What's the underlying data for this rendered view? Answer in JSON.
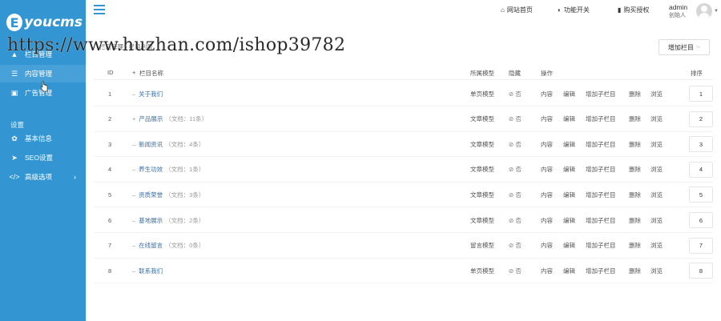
{
  "brand": {
    "logo_letter": "E",
    "logo_text": "youcms"
  },
  "sidebar": {
    "items": [
      {
        "label": "栏目管理",
        "icon": "sitemap-icon"
      },
      {
        "label": "内容管理",
        "icon": "list-icon"
      },
      {
        "label": "广告管理",
        "icon": "image-icon"
      }
    ],
    "section_label": "设置",
    "settings": [
      {
        "label": "基本信息",
        "icon": "gear-icon"
      },
      {
        "label": "SEO设置",
        "icon": "paper-plane-icon"
      },
      {
        "label": "高级选项",
        "icon": "code-icon",
        "chevron": "›"
      }
    ]
  },
  "topbar": {
    "links": [
      {
        "label": "网站首页",
        "icon": "home-icon"
      },
      {
        "label": "功能开关",
        "icon": "toggle-icon"
      },
      {
        "label": "购买授权",
        "icon": "bookmark-icon"
      }
    ],
    "admin_name": "admin",
    "admin_role": "创始人"
  },
  "page": {
    "breadcrumb": "栏目管理 › 栏目列表",
    "add_button": "增加栏目",
    "add_button_caret": "⌵"
  },
  "watermark": "https://www.huzhan.com/ishop39782",
  "table": {
    "headers": {
      "id": "ID",
      "expand": "+",
      "name": "栏目名称",
      "model": "所属模型",
      "hidden": "隐藏",
      "actions": "操作",
      "sort": "排序"
    },
    "rows": [
      {
        "id": "1",
        "prefix": "–",
        "name": "关于我们",
        "count": "",
        "model": "单页模型",
        "hidden": "⊘ 否",
        "sort": "1"
      },
      {
        "id": "2",
        "prefix": "+",
        "name": "产品展示",
        "count": "（文档：11条）",
        "model": "文章模型",
        "hidden": "⊘ 否",
        "sort": "2"
      },
      {
        "id": "3",
        "prefix": "–",
        "name": "新闻资讯",
        "count": "（文档：4条）",
        "model": "文章模型",
        "hidden": "⊘ 否",
        "sort": "3"
      },
      {
        "id": "4",
        "prefix": "–",
        "name": "养生功效",
        "count": "（文档：1条）",
        "model": "文章模型",
        "hidden": "⊘ 否",
        "sort": "4"
      },
      {
        "id": "5",
        "prefix": "–",
        "name": "资质荣誉",
        "count": "（文档：3条）",
        "model": "文章模型",
        "hidden": "⊘ 否",
        "sort": "5"
      },
      {
        "id": "6",
        "prefix": "–",
        "name": "基地展示",
        "count": "（文档：2条）",
        "model": "文章模型",
        "hidden": "⊘ 否",
        "sort": "6"
      },
      {
        "id": "7",
        "prefix": "–",
        "name": "在线留言",
        "count": "（文档：0条）",
        "model": "留言模型",
        "hidden": "⊘ 否",
        "sort": "7"
      },
      {
        "id": "8",
        "prefix": "–",
        "name": "联系我们",
        "count": "",
        "model": "单页模型",
        "hidden": "⊘ 否",
        "sort": "8"
      }
    ],
    "actions": [
      "内容",
      "编辑",
      "增加子栏目",
      "删除",
      "浏览"
    ]
  },
  "colors": {
    "sidebar": "#3396d3",
    "link": "#3a6fa8"
  }
}
